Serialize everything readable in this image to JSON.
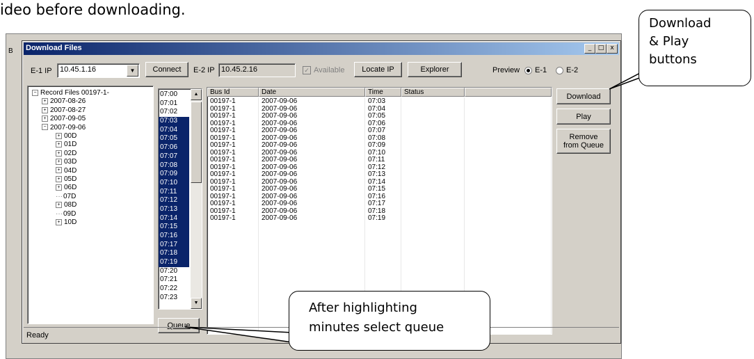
{
  "doc_text": "ideo before downloading.",
  "background": {
    "partial_char": "B"
  },
  "dialog": {
    "title": "Download Files",
    "title_buttons": [
      "_",
      "□",
      "x"
    ],
    "e1_label": "E-1 IP",
    "e1_value": "10.45.1.16",
    "connect_label": "Connect",
    "e2_label": "E-2 IP",
    "e2_value": "10.45.2.16",
    "available_label": "Available",
    "locate_label": "Locate IP",
    "explorer_label": "Explorer",
    "preview_label": "Preview",
    "preview_e1": "E-1",
    "preview_e2": "E-2",
    "preview_selected": "E-1",
    "download_label": "Download",
    "play_label": "Play",
    "remove_label_1": "Remove",
    "remove_label_2": "from Queue",
    "queue_label": "Queue",
    "status": "Ready"
  },
  "tree": [
    {
      "label": "Record Files 00197-1-",
      "level": 0,
      "expander": "minus"
    },
    {
      "label": "2007-08-26",
      "level": 1,
      "expander": "plus"
    },
    {
      "label": "2007-08-27",
      "level": 1,
      "expander": "plus"
    },
    {
      "label": "2007-09-05",
      "level": 1,
      "expander": "plus"
    },
    {
      "label": "2007-09-06",
      "level": 1,
      "expander": "minus"
    },
    {
      "label": "00D",
      "level": 2,
      "expander": "plus"
    },
    {
      "label": "01D",
      "level": 2,
      "expander": "plus"
    },
    {
      "label": "02D",
      "level": 2,
      "expander": "plus"
    },
    {
      "label": "03D",
      "level": 2,
      "expander": "plus"
    },
    {
      "label": "04D",
      "level": 2,
      "expander": "plus"
    },
    {
      "label": "05D",
      "level": 2,
      "expander": "plus"
    },
    {
      "label": "06D",
      "level": 2,
      "expander": "plus"
    },
    {
      "label": "07D",
      "level": 2,
      "expander": "none"
    },
    {
      "label": "08D",
      "level": 2,
      "expander": "plus"
    },
    {
      "label": "09D",
      "level": 2,
      "expander": "none"
    },
    {
      "label": "10D",
      "level": 2,
      "expander": "plus"
    }
  ],
  "minutes": [
    {
      "t": "07:00",
      "sel": false
    },
    {
      "t": "07:01",
      "sel": false
    },
    {
      "t": "07:02",
      "sel": false
    },
    {
      "t": "07:03",
      "sel": true
    },
    {
      "t": "07:04",
      "sel": true
    },
    {
      "t": "07:05",
      "sel": true
    },
    {
      "t": "07:06",
      "sel": true
    },
    {
      "t": "07:07",
      "sel": true
    },
    {
      "t": "07:08",
      "sel": true
    },
    {
      "t": "07:09",
      "sel": true
    },
    {
      "t": "07:10",
      "sel": true
    },
    {
      "t": "07:11",
      "sel": true
    },
    {
      "t": "07:12",
      "sel": true
    },
    {
      "t": "07:13",
      "sel": true
    },
    {
      "t": "07:14",
      "sel": true
    },
    {
      "t": "07:15",
      "sel": true
    },
    {
      "t": "07:16",
      "sel": true
    },
    {
      "t": "07:17",
      "sel": true
    },
    {
      "t": "07:18",
      "sel": true
    },
    {
      "t": "07:19",
      "sel": true
    },
    {
      "t": "07:20",
      "sel": false
    },
    {
      "t": "07:21",
      "sel": false
    },
    {
      "t": "07:22",
      "sel": false
    },
    {
      "t": "07:23",
      "sel": false
    }
  ],
  "table": {
    "columns": [
      "Bus Id",
      "Date",
      "Time",
      "Status",
      ""
    ],
    "rows": [
      [
        "00197-1",
        "2007-09-06",
        "07:03"
      ],
      [
        "00197-1",
        "2007-09-06",
        "07:04"
      ],
      [
        "00197-1",
        "2007-09-06",
        "07:05"
      ],
      [
        "00197-1",
        "2007-09-06",
        "07:06"
      ],
      [
        "00197-1",
        "2007-09-06",
        "07:07"
      ],
      [
        "00197-1",
        "2007-09-06",
        "07:08"
      ],
      [
        "00197-1",
        "2007-09-06",
        "07:09"
      ],
      [
        "00197-1",
        "2007-09-06",
        "07:10"
      ],
      [
        "00197-1",
        "2007-09-06",
        "07:11"
      ],
      [
        "00197-1",
        "2007-09-06",
        "07:12"
      ],
      [
        "00197-1",
        "2007-09-06",
        "07:13"
      ],
      [
        "00197-1",
        "2007-09-06",
        "07:14"
      ],
      [
        "00197-1",
        "2007-09-06",
        "07:15"
      ],
      [
        "00197-1",
        "2007-09-06",
        "07:16"
      ],
      [
        "00197-1",
        "2007-09-06",
        "07:17"
      ],
      [
        "00197-1",
        "2007-09-06",
        "07:18"
      ],
      [
        "00197-1",
        "2007-09-06",
        "07:19"
      ]
    ]
  },
  "callouts": {
    "top_right": [
      "Download",
      "& Play",
      "buttons"
    ],
    "bottom": [
      "After highlighting",
      "minutes select queue"
    ]
  },
  "colors": {
    "selection": "#0a246a",
    "titlebar": "#0a246a",
    "face": "#d4d0c8"
  }
}
